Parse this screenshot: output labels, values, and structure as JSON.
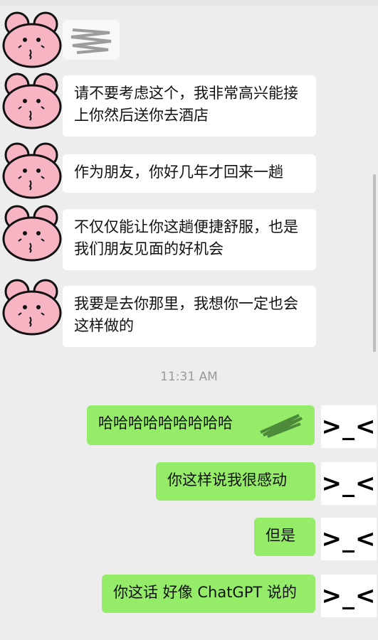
{
  "incoming": [
    {
      "text": "请不要考虑这个，我非常高兴能接上你然后送你去酒店"
    },
    {
      "text": "作为朋友，你好几年才回来一趟"
    },
    {
      "text": "不仅仅能让你这趟便捷舒服，也是我们朋友见面的好机会"
    },
    {
      "text": "我要是去你那里，我想你一定也会这样做的"
    }
  ],
  "timestamp": "11:31 AM",
  "outgoing": [
    {
      "text": "哈哈哈哈哈哈哈哈哈"
    },
    {
      "text": "你这样说我很感动"
    },
    {
      "text": "但是"
    },
    {
      "text": "你这话 好像 ChatGPT 说的"
    }
  ],
  "sender_avatar": {
    "icon": "pink-bunny-icon",
    "color": "#f7b5c4"
  },
  "self_avatar": {
    "text": ">_<"
  },
  "colors": {
    "incoming_bubble": "#ffffff",
    "outgoing_bubble": "#95ec69",
    "background": "#ededed"
  }
}
